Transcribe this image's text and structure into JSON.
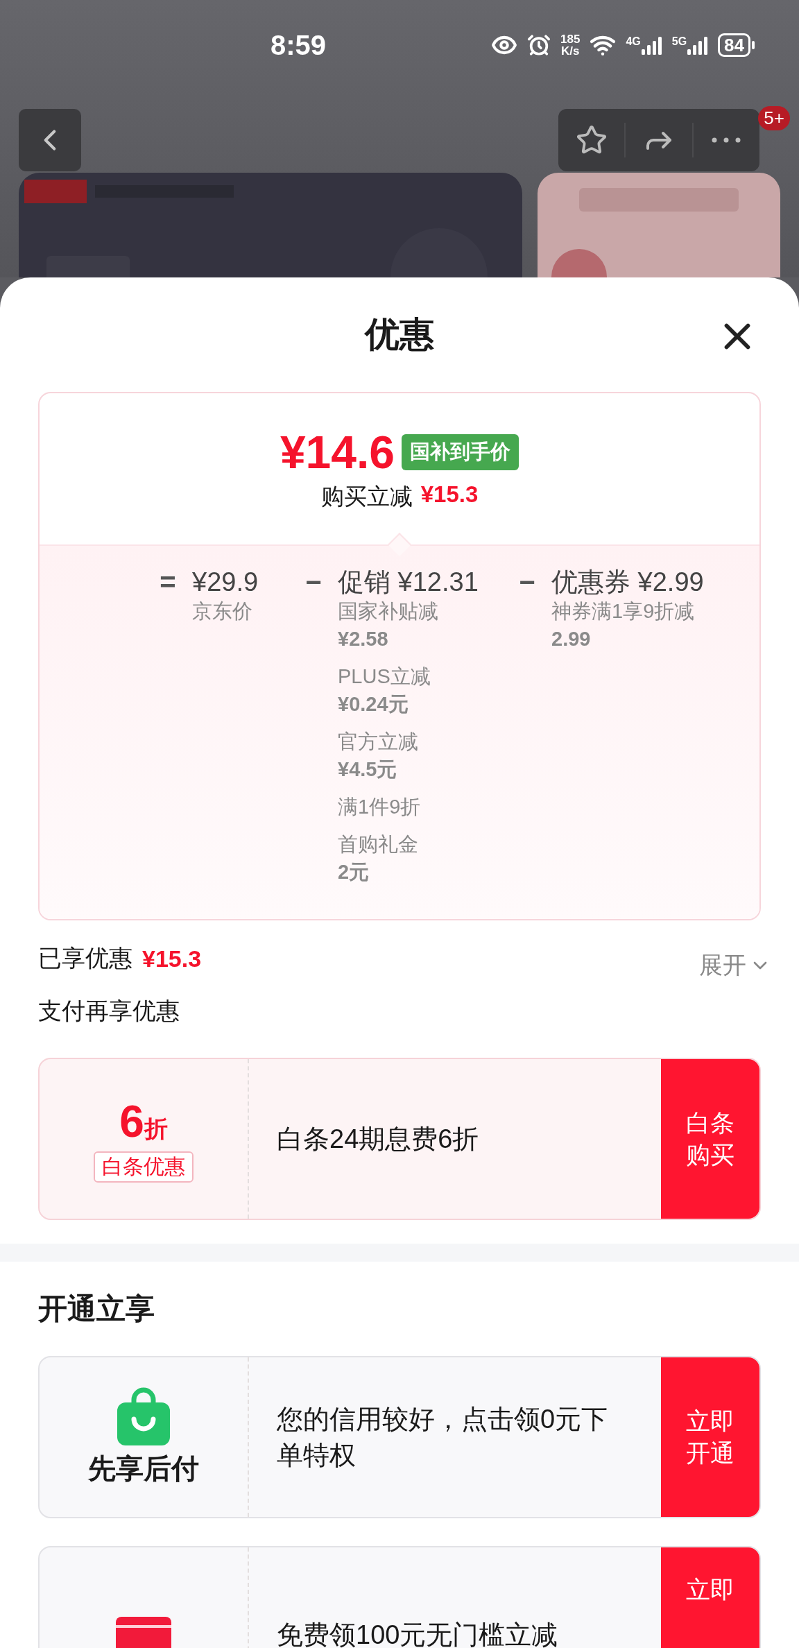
{
  "status_bar": {
    "time": "8:59",
    "net_speed": {
      "value": "185",
      "unit": "K/s"
    },
    "networks": [
      "4G",
      "5G"
    ],
    "battery": "84"
  },
  "top_nav": {
    "badge": "5+"
  },
  "sheet": {
    "title": "优惠"
  },
  "price_summary": {
    "price": "¥14.6",
    "tag": "国补到手价",
    "reduction_label": "购买立减",
    "reduction_amount": "¥15.3",
    "breakdown": [
      {
        "operator": "=",
        "heading": "¥29.9",
        "label": "京东价"
      },
      {
        "operator": "−",
        "heading": "促销 ¥12.31",
        "details": [
          {
            "name": "国家补贴减",
            "amount": "¥2.58"
          },
          {
            "name": "PLUS立减",
            "amount": "¥0.24元"
          },
          {
            "name": "官方立减",
            "amount": "¥4.5元"
          },
          {
            "name": "满1件9折"
          },
          {
            "name": "首购礼金",
            "amount": "2元"
          }
        ]
      },
      {
        "operator": "−",
        "heading": "优惠券 ¥2.99",
        "details": [
          {
            "name": "神券满1享9折减",
            "amount": "2.99"
          }
        ]
      }
    ]
  },
  "enjoyed": {
    "label": "已享优惠",
    "amount": "¥15.3",
    "expand": "展开"
  },
  "pay_section": {
    "title": "支付再享优惠",
    "offers": [
      {
        "kind": "discount",
        "value": "6",
        "unit": "折",
        "tag": "白条优惠",
        "description": "白条24期息费6折",
        "action": "白条购买"
      }
    ]
  },
  "open_section": {
    "title": "开通立享",
    "offers": [
      {
        "kind": "bag",
        "label": "先享后付",
        "description": "您的信用较好，点击领0元下单特权",
        "action": "立即开通"
      },
      {
        "kind": "card",
        "description": "免费领100元无门槛立减",
        "action": "立即"
      }
    ]
  }
}
